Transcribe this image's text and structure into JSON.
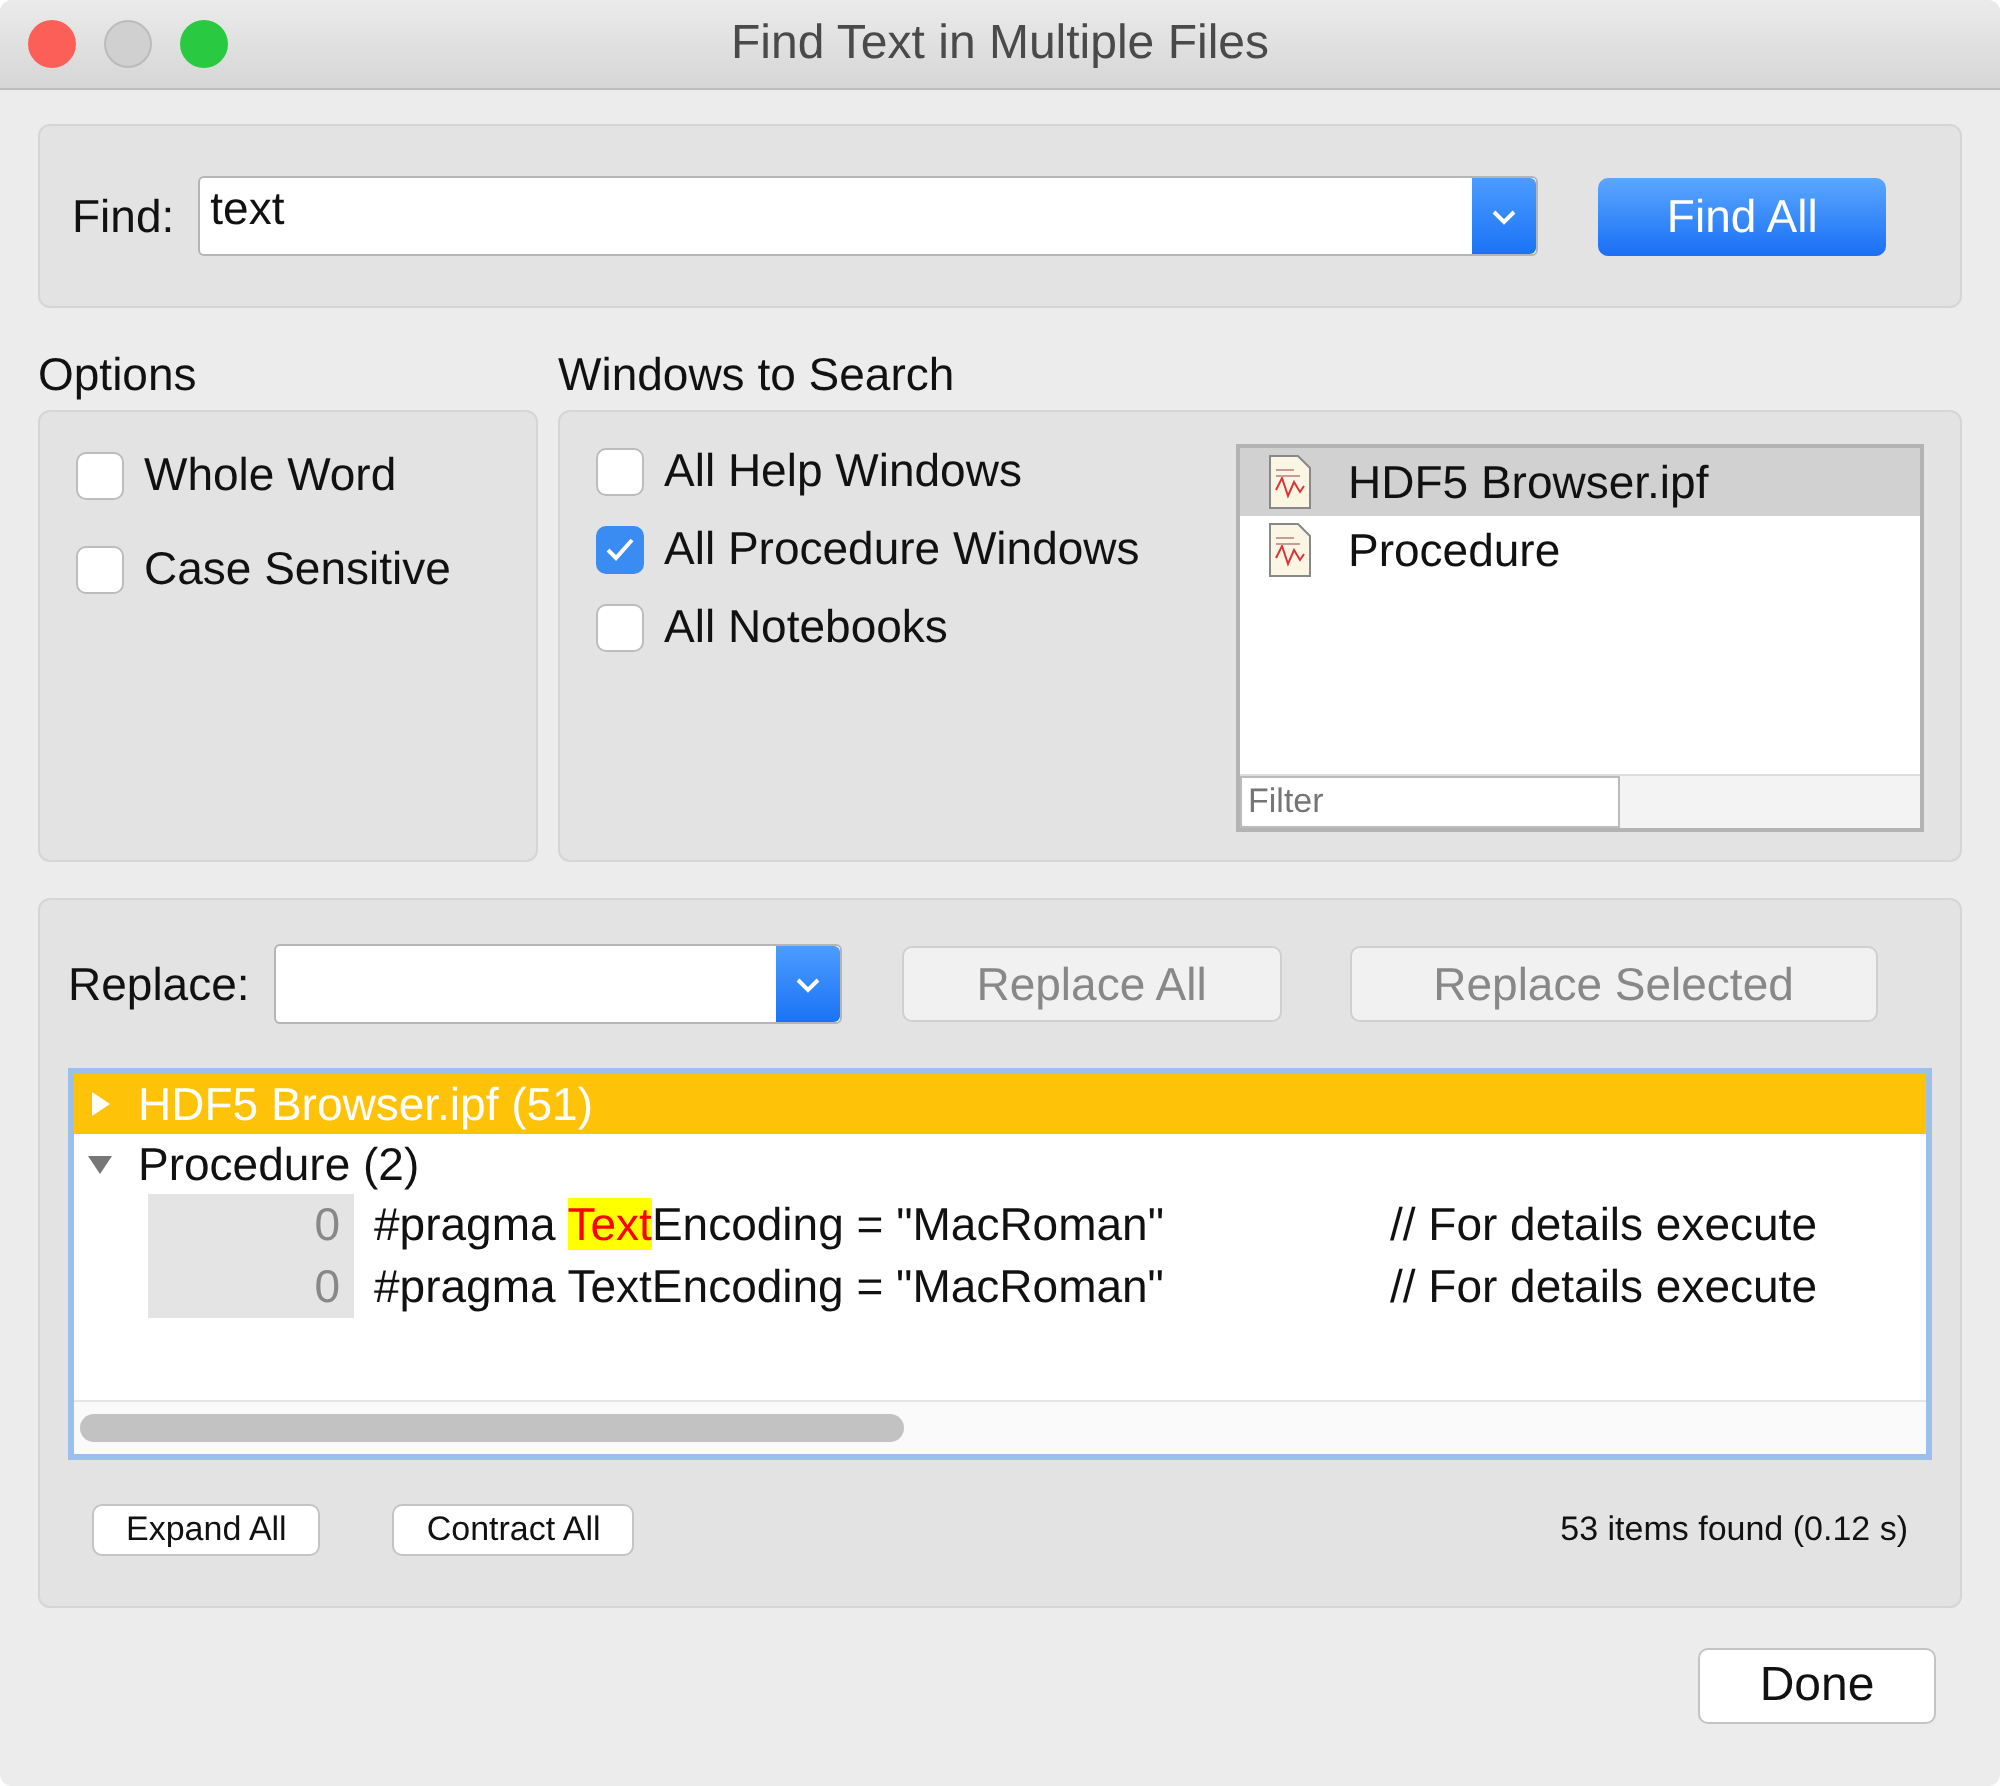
{
  "window": {
    "title": "Find Text in Multiple Files"
  },
  "find": {
    "label": "Find:",
    "value": "text",
    "button": "Find All"
  },
  "options": {
    "title": "Options",
    "items": [
      {
        "label": "Whole Word",
        "checked": false
      },
      {
        "label": "Case Sensitive",
        "checked": false
      }
    ]
  },
  "windows_to_search": {
    "title": "Windows to Search",
    "items": [
      {
        "label": "All Help Windows",
        "checked": false
      },
      {
        "label": "All Procedure Windows",
        "checked": true
      },
      {
        "label": "All Notebooks",
        "checked": false
      }
    ],
    "files": [
      {
        "name": "HDF5 Browser.ipf",
        "selected": true
      },
      {
        "name": "Procedure",
        "selected": false
      }
    ],
    "filter": {
      "placeholder": "Filter"
    }
  },
  "replace": {
    "label": "Replace:",
    "buttons": [
      {
        "label": "Replace All",
        "disabled": true
      },
      {
        "label": "Replace Selected",
        "disabled": true
      }
    ]
  },
  "results": [
    {
      "name": "HDF5 Browser.ipf (51)",
      "expanded": false,
      "selected": true
    },
    {
      "name": "Procedure (2)",
      "expanded": true,
      "selected": false,
      "children": [
        {
          "line": "0",
          "segments": [
            {
              "text": "#pragma ",
              "highlighted": false
            },
            {
              "text": "Text",
              "highlighted": true
            },
            {
              "text": "Encoding = \"MacRoman\"",
              "highlighted": false
            }
          ],
          "comment": "// For details execute"
        },
        {
          "line": "0",
          "segments": [
            {
              "text": "#pragma TextEncoding = \"MacRoman\"",
              "highlighted": false
            }
          ],
          "comment": "// For details execute"
        }
      ]
    }
  ],
  "footer": {
    "buttons": [
      "Expand All",
      "Contract All"
    ],
    "status": "53 items found (0.12 s)"
  },
  "done_button": "Done"
}
